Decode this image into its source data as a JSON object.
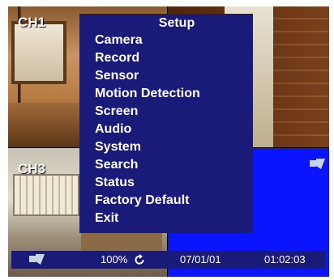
{
  "channels": {
    "ch1": "CH1",
    "ch3": "CH3"
  },
  "menu": {
    "title": "Setup",
    "items": [
      "Camera",
      "Record",
      "Sensor",
      "Motion Detection",
      "Screen",
      "Audio",
      "System",
      "Search",
      "Status",
      "Factory Default",
      "Exit"
    ]
  },
  "status_bar": {
    "zoom": "100%",
    "date": "07/01/01",
    "time": "01:02:03"
  },
  "icons": {
    "status_camera": "camera-icon",
    "quad4_camera": "camera-icon",
    "refresh": "refresh-icon"
  },
  "colors": {
    "menu_background": "#1a1a78",
    "quad4_background": "#0a14ff",
    "text": "#ffffff"
  }
}
